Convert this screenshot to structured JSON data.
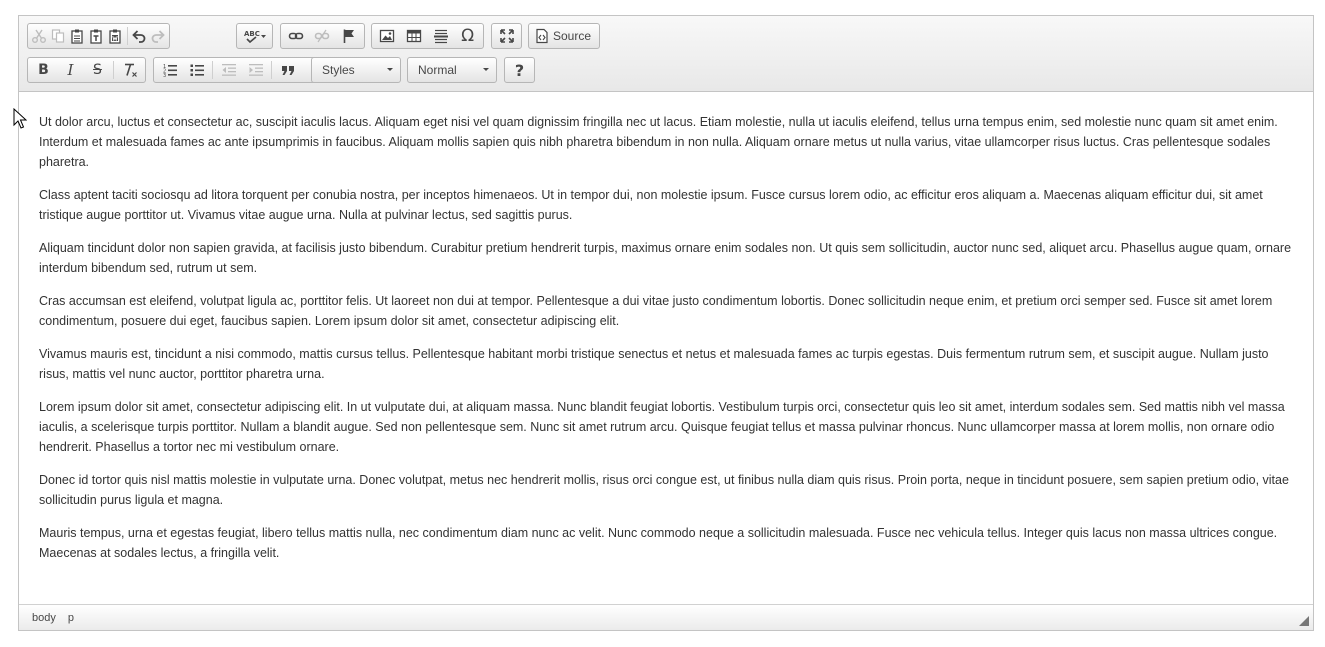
{
  "toolbar": {
    "source_label": "Source",
    "styles_label": "Styles",
    "format_label": "Normal",
    "bold_label": "B",
    "italic_label": "I",
    "strike_label": "S",
    "help_label": "?"
  },
  "content": {
    "paragraphs": [
      "Ut dolor arcu, luctus et consectetur ac, suscipit iaculis lacus. Aliquam eget nisi vel quam dignissim fringilla nec ut lacus. Etiam molestie, nulla ut iaculis eleifend, tellus urna tempus enim, sed molestie nunc quam sit amet enim. Interdum et malesuada fames ac ante ipsumprimis in faucibus. Aliquam mollis sapien quis nibh pharetra bibendum in non nulla. Aliquam ornare metus ut nulla varius, vitae ullamcorper risus luctus. Cras pellentesque sodales pharetra.",
      "Class aptent taciti sociosqu ad litora torquent per conubia nostra, per inceptos himenaeos. Ut in tempor dui, non molestie ipsum. Fusce cursus lorem odio, ac efficitur eros aliquam a. Maecenas aliquam efficitur dui, sit amet tristique augue porttitor ut. Vivamus vitae augue urna. Nulla at pulvinar lectus, sed sagittis purus.",
      "Aliquam tincidunt dolor non sapien gravida, at facilisis justo bibendum. Curabitur pretium hendrerit turpis, maximus ornare enim sodales non. Ut quis sem sollicitudin, auctor nunc sed, aliquet arcu. Phasellus augue quam, ornare interdum bibendum sed, rutrum ut sem.",
      "Cras accumsan est eleifend, volutpat ligula ac, porttitor felis. Ut laoreet non dui at tempor. Pellentesque a dui vitae justo condimentum lobortis. Donec sollicitudin neque enim, et pretium orci semper sed. Fusce sit amet lorem condimentum, posuere dui eget, faucibus sapien. Lorem ipsum dolor sit amet, consectetur adipiscing elit.",
      "Vivamus mauris est, tincidunt a nisi commodo, mattis cursus tellus. Pellentesque habitant morbi tristique senectus et netus et malesuada fames ac turpis egestas. Duis fermentum rutrum sem, et suscipit augue. Nullam justo risus, mattis vel nunc auctor, porttitor pharetra urna.",
      "Lorem ipsum dolor sit amet, consectetur adipiscing elit. In ut vulputate dui, at aliquam massa. Nunc blandit feugiat lobortis. Vestibulum turpis orci, consectetur quis leo sit amet, interdum sodales sem. Sed mattis nibh vel massa iaculis, a scelerisque turpis porttitor. Nullam a blandit augue. Sed non pellentesque sem. Nunc sit amet rutrum arcu. Quisque feugiat tellus et massa pulvinar rhoncus. Nunc ullamcorper massa at lorem mollis, non ornare odio hendrerit. Phasellus a tortor nec mi vestibulum ornare.",
      "Donec id tortor quis nisl mattis molestie in vulputate urna. Donec volutpat, metus nec hendrerit mollis, risus orci congue est, ut finibus nulla diam quis risus. Proin porta, neque in tincidunt posuere, sem sapien pretium odio, vitae sollicitudin purus ligula et magna.",
      "Mauris tempus, urna et egestas feugiat, libero tellus mattis nulla, nec condimentum diam nunc ac velit. Nunc commodo neque a sollicitudin malesuada. Fusce nec vehicula tellus. Integer quis lacus non massa ultrices congue. Maecenas at sodales lectus, a fringilla velit."
    ]
  },
  "statusbar": {
    "path": [
      "body",
      "p"
    ]
  },
  "icons": {
    "cut": "scissors-icon",
    "copy": "copy-icon",
    "paste": "paste-icon",
    "paste_text": "paste-text-icon",
    "paste_word": "paste-word-icon",
    "undo": "undo-icon",
    "redo": "redo-icon",
    "spellcheck": "spellcheck-icon",
    "link": "link-icon",
    "unlink": "unlink-icon",
    "anchor": "flag-icon",
    "image": "image-icon",
    "table": "table-icon",
    "hr": "horizontal-line-icon",
    "special_char": "omega-icon",
    "maximize": "maximize-icon",
    "source": "source-icon",
    "remove_format": "remove-format-icon",
    "numbered_list": "numbered-list-icon",
    "bulleted_list": "bulleted-list-icon",
    "outdent": "outdent-icon",
    "indent": "indent-icon",
    "blockquote": "blockquote-icon"
  }
}
